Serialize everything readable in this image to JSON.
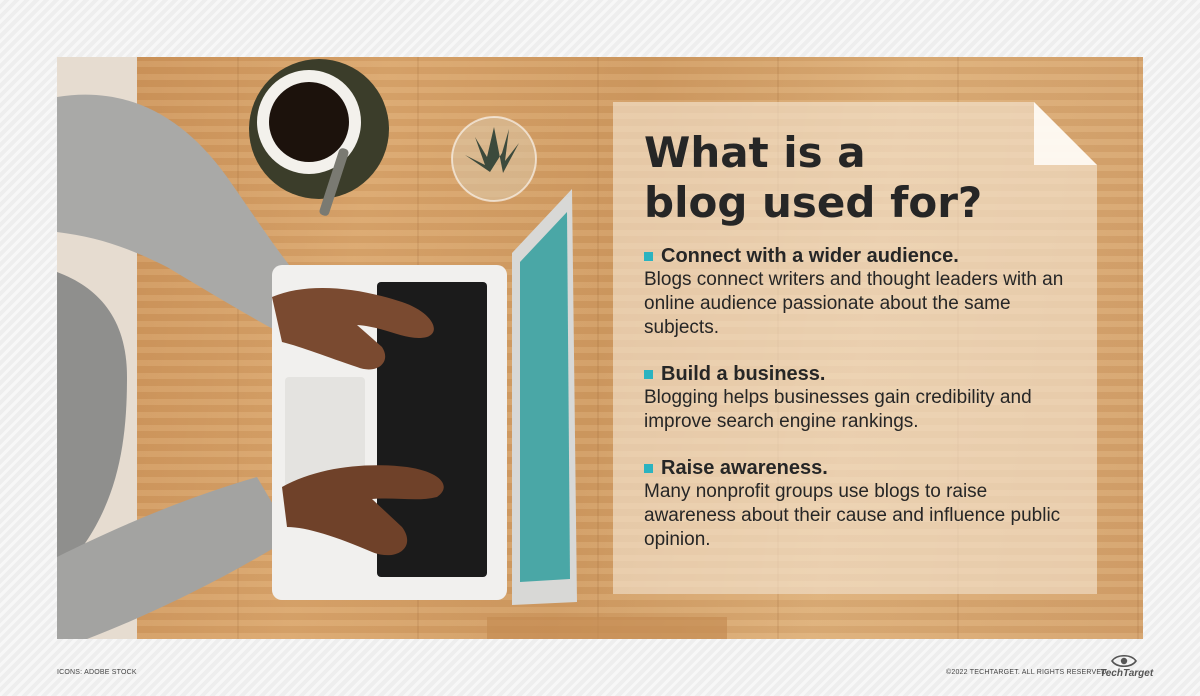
{
  "infographic": {
    "title_line1": "What is a",
    "title_line2": "blog used for?",
    "items": [
      {
        "heading": "Connect with a wider audience.",
        "body": "Blogs connect writers and thought leaders with an online audience passionate about the same subjects."
      },
      {
        "heading": "Build a business.",
        "body": "Blogging helps businesses gain credibility and improve search engine rankings."
      },
      {
        "heading": "Raise awareness.",
        "body": "Many nonprofit groups use blogs to raise awareness about their cause and influence public opinion."
      }
    ]
  },
  "footer": {
    "credit_left": "ICONS: ADOBE STOCK",
    "credit_right": "©2022 TECHTARGET. ALL RIGHTS RESERVED",
    "logo_text": "TechTarget"
  },
  "colors": {
    "accent": "#2bb3c0",
    "text": "#262626",
    "wood": "#d9a56c"
  },
  "icons": {
    "logo": "eye-icon"
  }
}
